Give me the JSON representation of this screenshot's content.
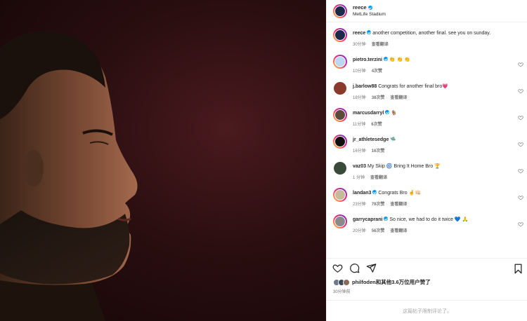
{
  "post": {
    "username": "reece",
    "location": "MetLife Stadium"
  },
  "caption": {
    "username": "reece",
    "text": "another competition, another final. see you on sunday.",
    "time": "30分钟",
    "translate": "查看翻译"
  },
  "comments": [
    {
      "username": "pietro.terzini",
      "text": "👏 👏 👏",
      "time": "10分钟",
      "likes": "4次赞",
      "reply": "",
      "verified": true,
      "avatar_color": "#bcd7ef",
      "ring": true
    },
    {
      "username": "j.barlow88",
      "text": "Congrats for another final bro💗",
      "time": "18分钟",
      "likes": "38次赞",
      "reply": "查看翻译",
      "verified": false,
      "avatar_color": "#8a3a2a",
      "ring": false
    },
    {
      "username": "marcusdarryl",
      "text": "🐐",
      "time": "11分钟",
      "likes": "6次赞",
      "reply": "",
      "verified": true,
      "avatar_color": "#5b4a3a",
      "ring": true
    },
    {
      "username": "jr_athletesedge",
      "text": "🛸",
      "time": "16分钟",
      "likes": "16次赞",
      "reply": "",
      "verified": false,
      "avatar_color": "#111111",
      "ring": true
    },
    {
      "username": "vaz03",
      "text": "My Skip 🌀 Bring It Home Bro 🏆",
      "time": "1 分钟",
      "likes": "",
      "reply": "查看翻译",
      "verified": false,
      "avatar_color": "#3a4a3a",
      "ring": false
    },
    {
      "username": "landan3",
      "text": "Congrats Bro 🤞👊🏻",
      "time": "23分钟",
      "likes": "79次赞",
      "reply": "查看翻译",
      "verified": true,
      "avatar_color": "#c9b89a",
      "ring": true
    },
    {
      "username": "garrycaprani",
      "text": "So nice, we had to do it twice 💙 🙏",
      "time": "20分钟",
      "likes": "56次赞",
      "reply": "查看翻译",
      "verified": true,
      "avatar_color": "#8a8a8a",
      "ring": true
    }
  ],
  "likes": {
    "text": "philfoden和其他3.6万位用户赞了",
    "time": "30分钟前"
  },
  "footer": {
    "text": "这篇帖子限制评论了。"
  },
  "icons": {
    "like": "heart-icon",
    "comment": "comment-icon",
    "share": "share-icon",
    "save": "bookmark-icon",
    "verified": "verified-badge-icon"
  },
  "colors": {
    "accent": "#0095f6",
    "photo_bg": "#2a0e10",
    "ring_start": "#f9ce34",
    "ring_mid": "#ee2a7b",
    "ring_end": "#6228d7"
  }
}
